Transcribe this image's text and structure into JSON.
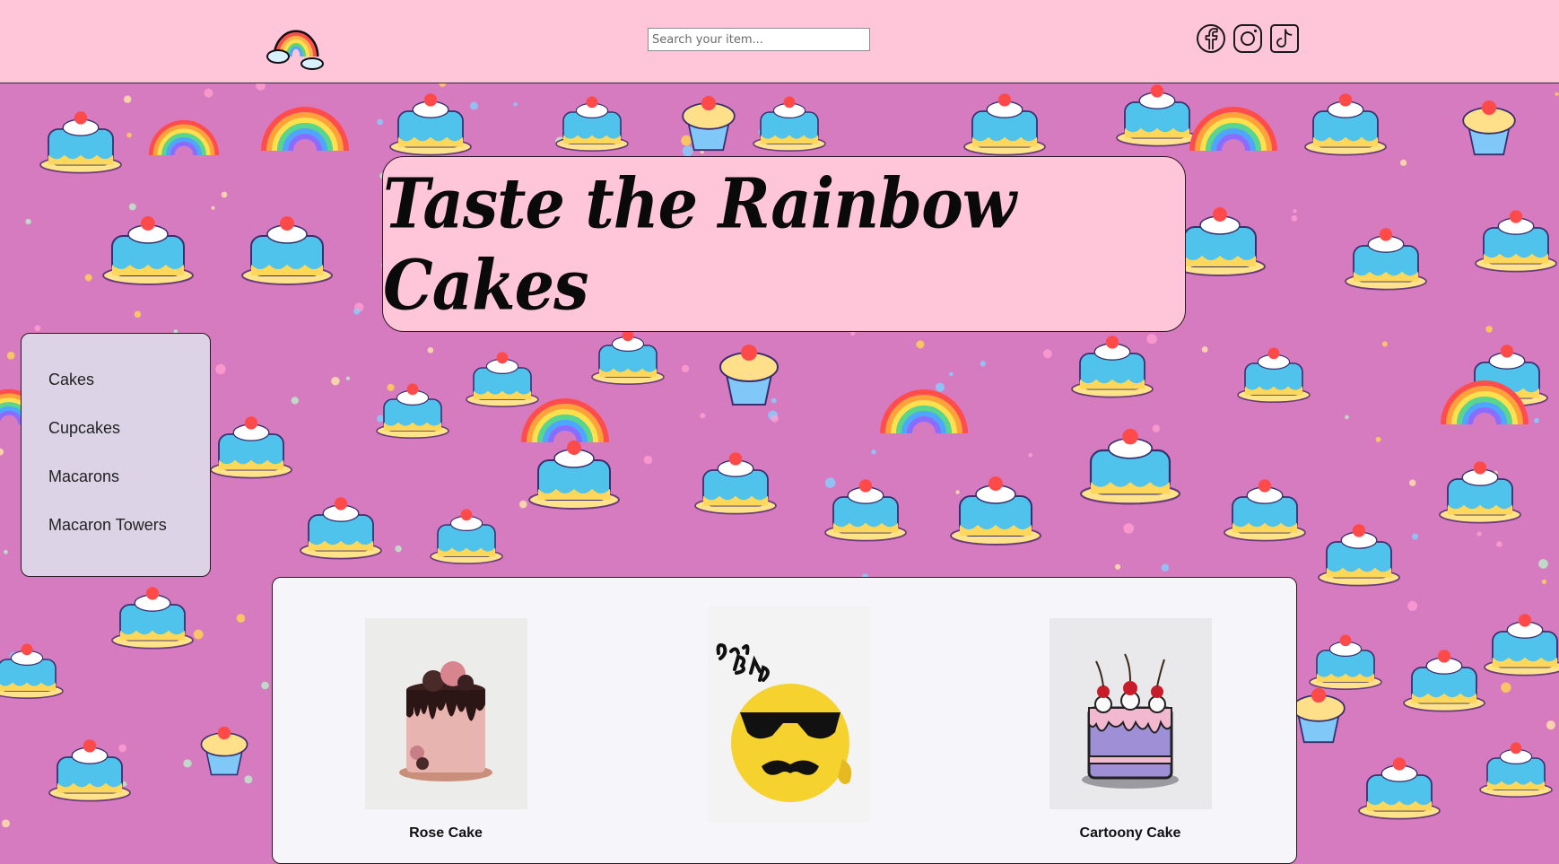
{
  "header": {
    "search_placeholder": "Search your item...",
    "background": "#ffc5d9",
    "logo_icon": "rainbow-logo-icon",
    "social_icons": [
      "facebook-icon",
      "instagram-icon",
      "tiktok-icon"
    ]
  },
  "banner": {
    "title": "Taste the Rainbow Cakes"
  },
  "sidebar": {
    "items": [
      {
        "label": "Cakes"
      },
      {
        "label": "Cupcakes"
      },
      {
        "label": "Macarons"
      },
      {
        "label": "Macaron Towers"
      }
    ]
  },
  "products": [
    {
      "name": "Rose Cake",
      "image": "pink-drip-cake-photo"
    },
    {
      "name": "",
      "image": "best-dad-ever-emoji-cake-photo"
    },
    {
      "name": "Cartoony Cake",
      "image": "cartoony-cherry-cake-photo"
    }
  ],
  "colors": {
    "header_bg": "#ffc5d9",
    "page_bg": "#d77bc0",
    "nav_bg": "#dcd4e6",
    "panel_bg": "#f6f5fa"
  }
}
